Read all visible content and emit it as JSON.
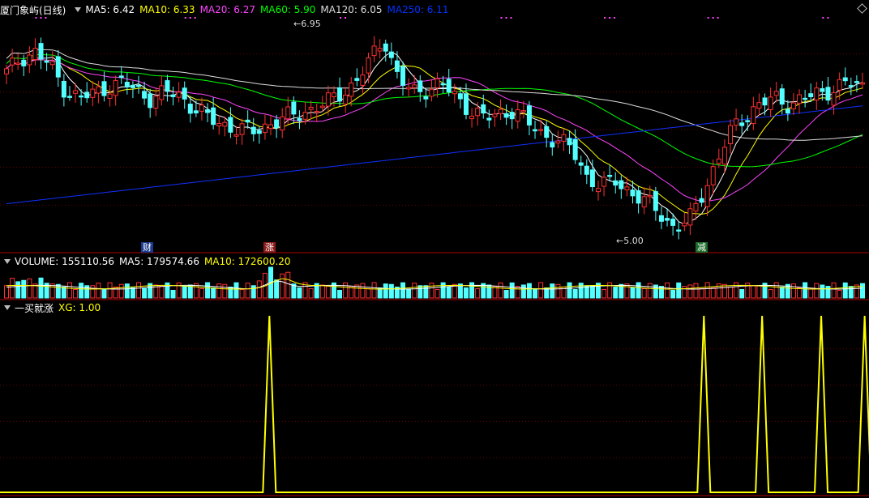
{
  "header": {
    "stock_name": "厦门象屿(日线)",
    "ma_items": [
      {
        "label": "MA5: 6.42",
        "color": "#ffffff"
      },
      {
        "label": "MA10: 6.33",
        "color": "#ffff00"
      },
      {
        "label": "MA20: 6.27",
        "color": "#ff44ff"
      },
      {
        "label": "MA60: 5.90",
        "color": "#00ff00"
      },
      {
        "label": "MA120: 6.05",
        "color": "#dddddd"
      },
      {
        "label": "MA250: 6.11",
        "color": "#0033ff"
      }
    ]
  },
  "volume_panel": {
    "items": [
      {
        "label": "VOLUME: 155110.56",
        "color": "#ffffff"
      },
      {
        "label": "MA5: 179574.66",
        "color": "#ffffff"
      },
      {
        "label": "MA10: 172600.20",
        "color": "#ffff00"
      }
    ]
  },
  "indicator_panel": {
    "name": "一买就涨",
    "value_label": "XG: 1.00",
    "value_color": "#ffff00"
  },
  "annotations": {
    "high_label": "6.95",
    "low_label": "5.00"
  },
  "event_markers": [
    {
      "text": "财",
      "bg": "#1b3a8c",
      "fg": "#ffffff"
    },
    {
      "text": "涨",
      "bg": "#8c1b1b",
      "fg": "#ffffff"
    },
    {
      "text": "减",
      "bg": "#1b6b2a",
      "fg": "#ffffff"
    }
  ],
  "colors": {
    "up": "#ff3030",
    "down": "#54ffff",
    "grid": "#6b0000",
    "panel_border": "#b00000",
    "signal": "#ffff00"
  },
  "chart_data": [
    {
      "type": "candlestick",
      "title": "厦门象屿(日线)",
      "ylim": [
        4.9,
        7.1
      ],
      "series": [
        {
          "name": "MA5",
          "value": 6.42
        },
        {
          "name": "MA10",
          "value": 6.33
        },
        {
          "name": "MA20",
          "value": 6.27
        },
        {
          "name": "MA60",
          "value": 5.9
        },
        {
          "name": "MA120",
          "value": 6.05
        },
        {
          "name": "MA250",
          "value": 6.11
        }
      ],
      "marked_high": 6.95,
      "marked_low": 5.0,
      "close_path": [
        6.55,
        6.7,
        6.75,
        6.62,
        6.4,
        6.3,
        6.35,
        6.42,
        6.45,
        6.38,
        6.3,
        6.36,
        6.33,
        6.2,
        6.1,
        6.05,
        6.0,
        5.98,
        6.05,
        6.1,
        6.15,
        6.2,
        6.25,
        6.35,
        6.45,
        6.65,
        6.9,
        6.5,
        6.35,
        6.4,
        6.45,
        6.3,
        6.2,
        6.1,
        6.15,
        6.2,
        6.05,
        5.95,
        5.9,
        5.8,
        5.55,
        5.45,
        5.5,
        5.4,
        5.3,
        5.2,
        5.05,
        5.1,
        5.4,
        5.7,
        6.0,
        6.15,
        6.25,
        6.3,
        6.25,
        6.3,
        6.35,
        6.4,
        6.45,
        6.42
      ]
    },
    {
      "type": "bar",
      "title": "VOLUME",
      "series": [
        {
          "name": "VOLUME",
          "value": 155110.56
        },
        {
          "name": "MA5",
          "value": 179574.66
        },
        {
          "name": "MA10",
          "value": 172600.2
        }
      ]
    },
    {
      "type": "line",
      "title": "一买就涨",
      "ylim": [
        0,
        1
      ],
      "series": [
        {
          "name": "XG",
          "value": 1.0,
          "signal_index_fractions": [
            0.31,
            0.81,
            0.877,
            0.945,
            0.995
          ]
        }
      ]
    }
  ]
}
